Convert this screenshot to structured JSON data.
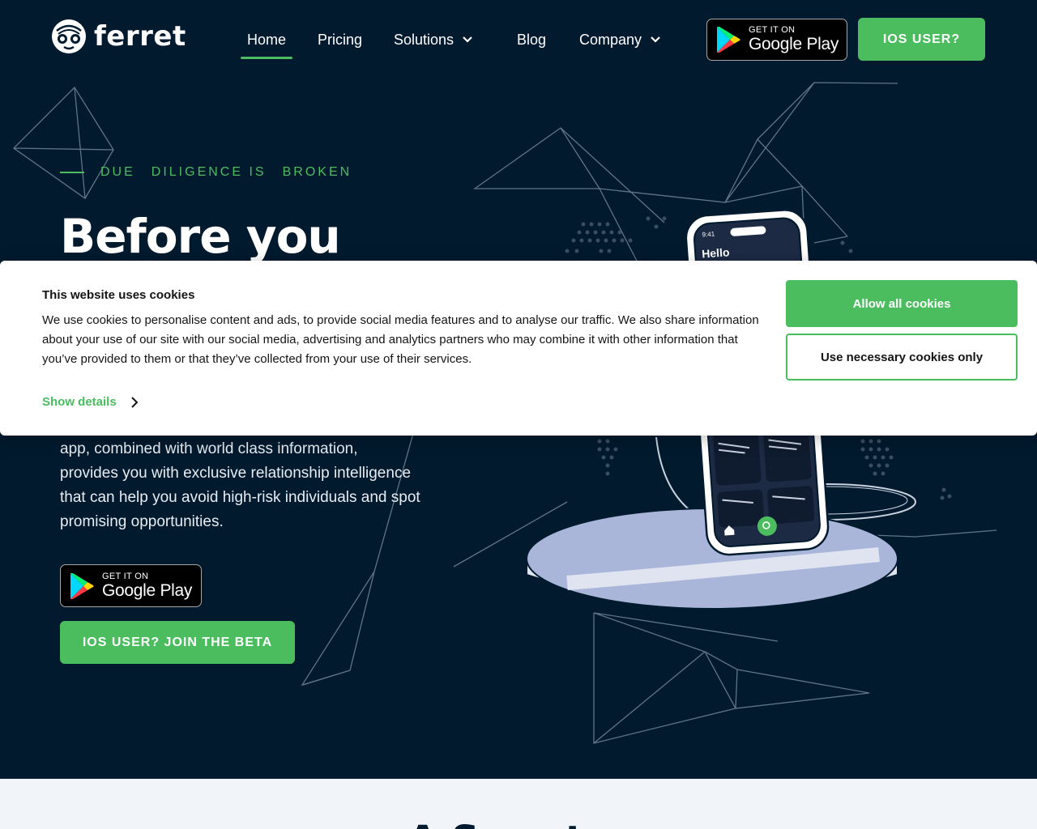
{
  "brand": {
    "name": "ferret"
  },
  "nav": {
    "items": [
      {
        "label": "Home",
        "active": true
      },
      {
        "label": "Pricing",
        "active": false
      },
      {
        "label": "Solutions",
        "active": false,
        "dropdown": true
      },
      {
        "label": "Blog",
        "active": false
      },
      {
        "label": "Company",
        "active": false,
        "dropdown": true
      }
    ]
  },
  "header": {
    "google_play": {
      "small": "GET IT ON",
      "big": "Google Play"
    },
    "ios_button": "IOS USER?"
  },
  "hero": {
    "eyebrow": [
      "DUE",
      "DILIGENCE IS",
      "BROKEN"
    ],
    "headline": "Before you",
    "body_lines": [
      "app, combined with world class information,",
      "provides you with exclusive relationship intelligence",
      "that can help you avoid high-risk individuals and spot",
      "promising opportunities."
    ],
    "google_play": {
      "small": "GET IT ON",
      "big": "Google Play"
    },
    "beta_button": "IOS USER? JOIN THE BETA",
    "phone_greeting": "Hello",
    "phone_time": "9:41"
  },
  "cookie_banner": {
    "title": "This website uses cookies",
    "text": "We use cookies to personalise content and ads, to provide social media features and to analyse our traffic. We also share information about your use of our site with our social media, advertising and analytics partners who may combine it with other information that you’ve provided to them or that they’ve collected from your use of their services.",
    "details_label": "Show details",
    "allow_all_label": "Allow all cookies",
    "necessary_label": "Use necessary cookies only"
  },
  "lower_section": {
    "title": "A Smarter"
  },
  "colors": {
    "background": "#021a2e",
    "accent": "#4bbd5f",
    "banner": "#ffffff",
    "lower_bg": "#f1f4f9"
  }
}
